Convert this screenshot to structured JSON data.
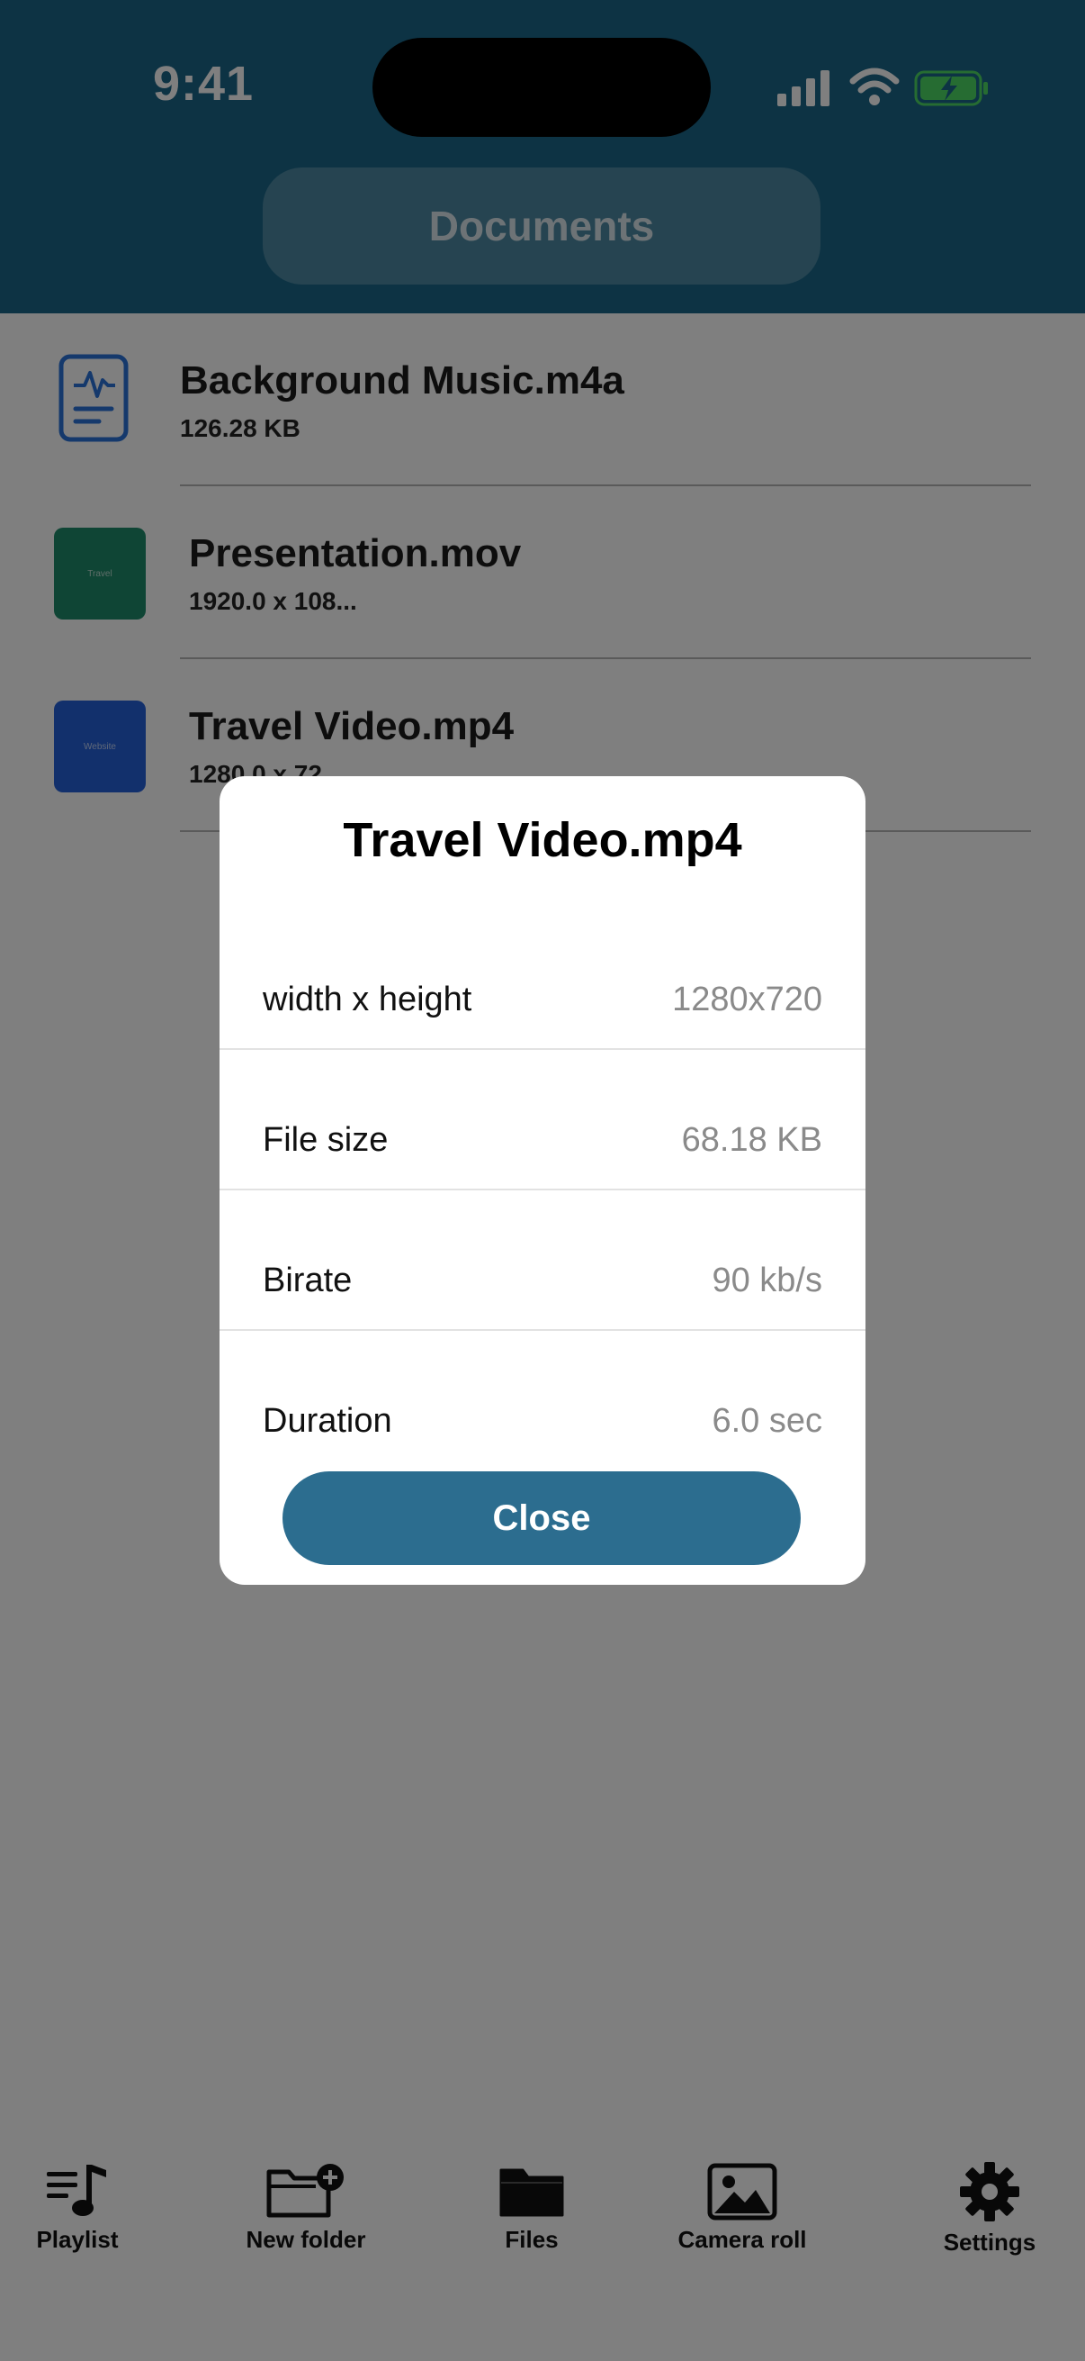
{
  "status_bar": {
    "time": "9:41"
  },
  "header": {
    "title": "Documents"
  },
  "files": [
    {
      "name": "Background Music.m4a",
      "detail": "126.28 KB",
      "type": "audio"
    },
    {
      "name": "Presentation.mov",
      "detail": "1920.0 x 108...",
      "type": "video",
      "thumb_color": "#1f8a6a",
      "thumb_text": "Travel"
    },
    {
      "name": "Travel Video.mp4",
      "detail": "1280.0 x 72...",
      "type": "video",
      "thumb_color": "#2460d8",
      "thumb_text": "Website"
    }
  ],
  "dialog": {
    "title": "Travel Video.mp4",
    "rows": [
      {
        "label": "width x height",
        "value": "1280x720"
      },
      {
        "label": "File size",
        "value": "68.18 KB"
      },
      {
        "label": "Birate",
        "value": "90 kb/s"
      },
      {
        "label": "Duration",
        "value": "6.0 sec"
      }
    ],
    "close_label": "Close"
  },
  "tabbar": [
    {
      "label": "Playlist",
      "icon": "playlist-icon"
    },
    {
      "label": "New folder",
      "icon": "new-folder-icon"
    },
    {
      "label": "Files",
      "icon": "folder-icon"
    },
    {
      "label": "Camera roll",
      "icon": "image-icon"
    },
    {
      "label": "Settings",
      "icon": "gear-icon"
    }
  ],
  "colors": {
    "header_bg": "#1a6788",
    "accent_button": "#2c6d8f",
    "overlay": "rgba(0,0,0,0.5)"
  }
}
